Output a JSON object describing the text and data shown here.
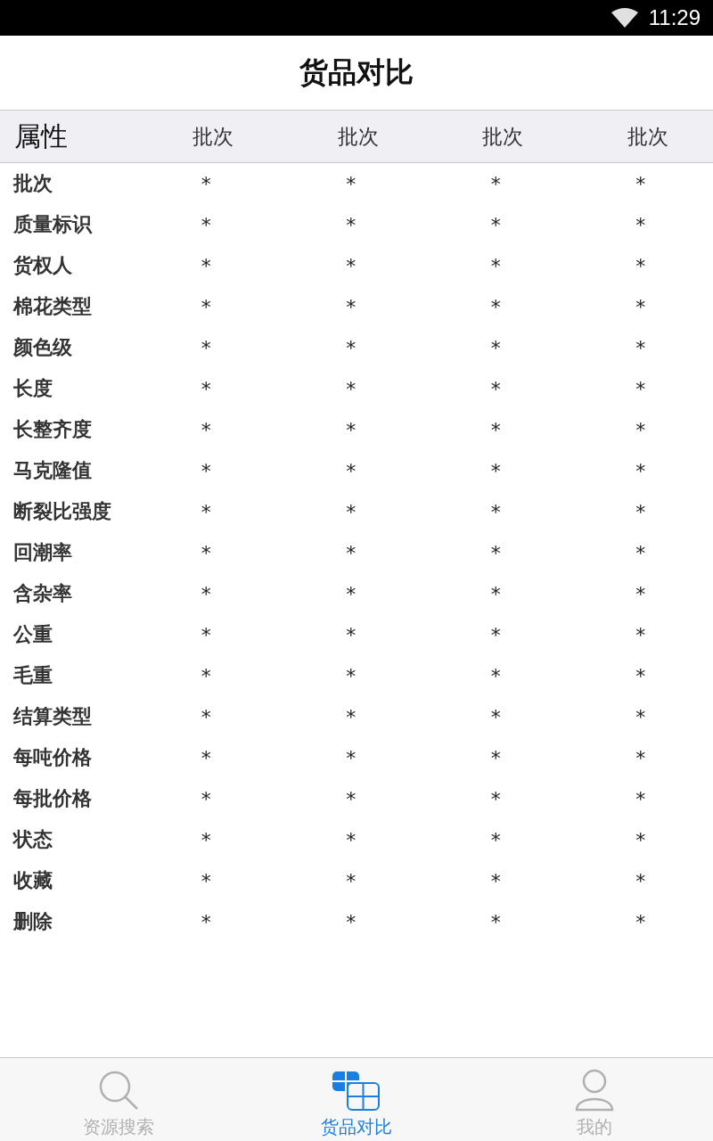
{
  "status_bar": {
    "time": "11:29"
  },
  "title": "货品对比",
  "table": {
    "columns": [
      "属性",
      "批次",
      "批次",
      "批次",
      "批次"
    ],
    "rows": [
      {
        "label": "批次",
        "values": [
          "*",
          "*",
          "*",
          "*"
        ]
      },
      {
        "label": "质量标识",
        "values": [
          "*",
          "*",
          "*",
          "*"
        ]
      },
      {
        "label": "货权人",
        "values": [
          "*",
          "*",
          "*",
          "*"
        ]
      },
      {
        "label": "棉花类型",
        "values": [
          "*",
          "*",
          "*",
          "*"
        ]
      },
      {
        "label": "颜色级",
        "values": [
          "*",
          "*",
          "*",
          "*"
        ]
      },
      {
        "label": "长度",
        "values": [
          "*",
          "*",
          "*",
          "*"
        ]
      },
      {
        "label": "长整齐度",
        "values": [
          "*",
          "*",
          "*",
          "*"
        ]
      },
      {
        "label": "马克隆值",
        "values": [
          "*",
          "*",
          "*",
          "*"
        ]
      },
      {
        "label": "断裂比强度",
        "values": [
          "*",
          "*",
          "*",
          "*"
        ]
      },
      {
        "label": "回潮率",
        "values": [
          "*",
          "*",
          "*",
          "*"
        ]
      },
      {
        "label": "含杂率",
        "values": [
          "*",
          "*",
          "*",
          "*"
        ]
      },
      {
        "label": "公重",
        "values": [
          "*",
          "*",
          "*",
          "*"
        ]
      },
      {
        "label": "毛重",
        "values": [
          "*",
          "*",
          "*",
          "*"
        ]
      },
      {
        "label": "结算类型",
        "values": [
          "*",
          "*",
          "*",
          "*"
        ]
      },
      {
        "label": "每吨价格",
        "values": [
          "*",
          "*",
          "*",
          "*"
        ]
      },
      {
        "label": "每批价格",
        "values": [
          "*",
          "*",
          "*",
          "*"
        ]
      },
      {
        "label": "状态",
        "values": [
          "*",
          "*",
          "*",
          "*"
        ]
      },
      {
        "label": "收藏",
        "values": [
          "*",
          "*",
          "*",
          "*"
        ]
      },
      {
        "label": "删除",
        "values": [
          "*",
          "*",
          "*",
          "*"
        ]
      }
    ]
  },
  "tabs": [
    {
      "label": "资源搜索",
      "kind": "search",
      "selected": false
    },
    {
      "label": "货品对比",
      "kind": "compare",
      "selected": true
    },
    {
      "label": "我的",
      "kind": "user",
      "selected": false
    }
  ]
}
